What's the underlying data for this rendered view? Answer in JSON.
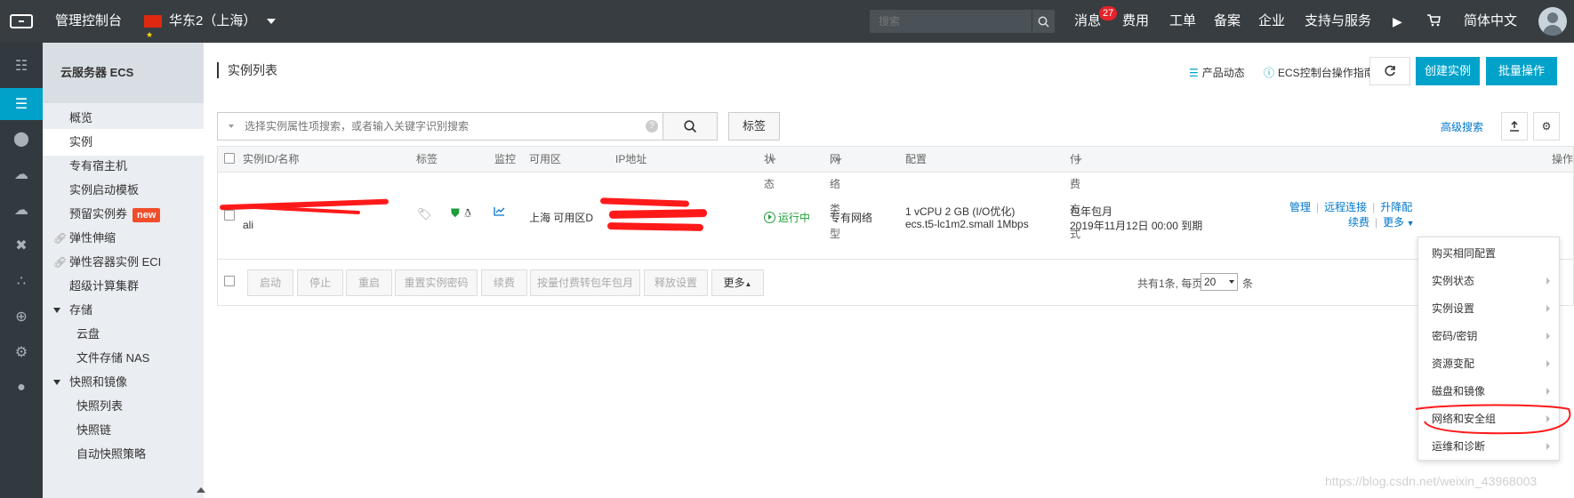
{
  "topbar": {
    "console_title": "管理控制台",
    "region": "华东2（上海）",
    "search_placeholder": "搜索",
    "nav": [
      "消息",
      "费用",
      "工单",
      "备案",
      "企业",
      "支持与服务",
      "简体中文"
    ],
    "message_badge": "27"
  },
  "sidebar": {
    "header": "云服务器 ECS",
    "items": [
      {
        "label": "概览"
      },
      {
        "label": "实例"
      },
      {
        "label": "专有宿主机"
      },
      {
        "label": "实例启动模板"
      },
      {
        "label": "预留实例券",
        "tag": "new"
      },
      {
        "label": "弹性伸缩"
      },
      {
        "label": "弹性容器实例 ECI"
      },
      {
        "label": "超级计算集群"
      },
      {
        "label": "存储"
      },
      {
        "label": "云盘"
      },
      {
        "label": "文件存储 NAS"
      },
      {
        "label": "快照和镜像"
      },
      {
        "label": "快照列表"
      },
      {
        "label": "快照链"
      },
      {
        "label": "自动快照策略"
      }
    ]
  },
  "main": {
    "page_title": "实例列表",
    "product_news": "产品动态",
    "console_guide": "ECS控制台操作指南",
    "create_instance": "创建实例",
    "batch_ops": "批量操作",
    "filter_placeholder": "选择实例属性项搜索，或者输入关键字识别搜索",
    "tag_button": "标签",
    "advanced_search": "高级搜索"
  },
  "table": {
    "columns": [
      "实例ID/名称",
      "标签",
      "监控",
      "可用区",
      "IP地址",
      "状态",
      "网络类型",
      "配置",
      "付费方式",
      "操作"
    ],
    "row": {
      "name": "ali",
      "zone": "上海 可用区D",
      "status": "运行中",
      "network": "专有网络",
      "config_line1": "1 vCPU 2 GB (I/O优化)",
      "config_line2": "ecs.t5-lc1m2.small   1Mbps",
      "billing_line1": "包年包月",
      "billing_line2": "2019年11月12日 00:00 到期",
      "ops": [
        "管理",
        "远程连接",
        "升降配",
        "续费",
        "更多"
      ]
    }
  },
  "footer": {
    "buttons": [
      "启动",
      "停止",
      "重启",
      "重置实例密码",
      "续费",
      "按量付费转包年包月",
      "释放设置",
      "更多"
    ],
    "total_text": "共有1条, 每页显示:",
    "page_size": "20",
    "unit": "条"
  },
  "dropdown": {
    "items": [
      "购买相同配置",
      "实例状态",
      "实例设置",
      "密码/密钥",
      "资源变配",
      "磁盘和镜像",
      "网络和安全组",
      "运维和诊断"
    ]
  },
  "watermark": "https://blog.csdn.net/weixin_43968003"
}
